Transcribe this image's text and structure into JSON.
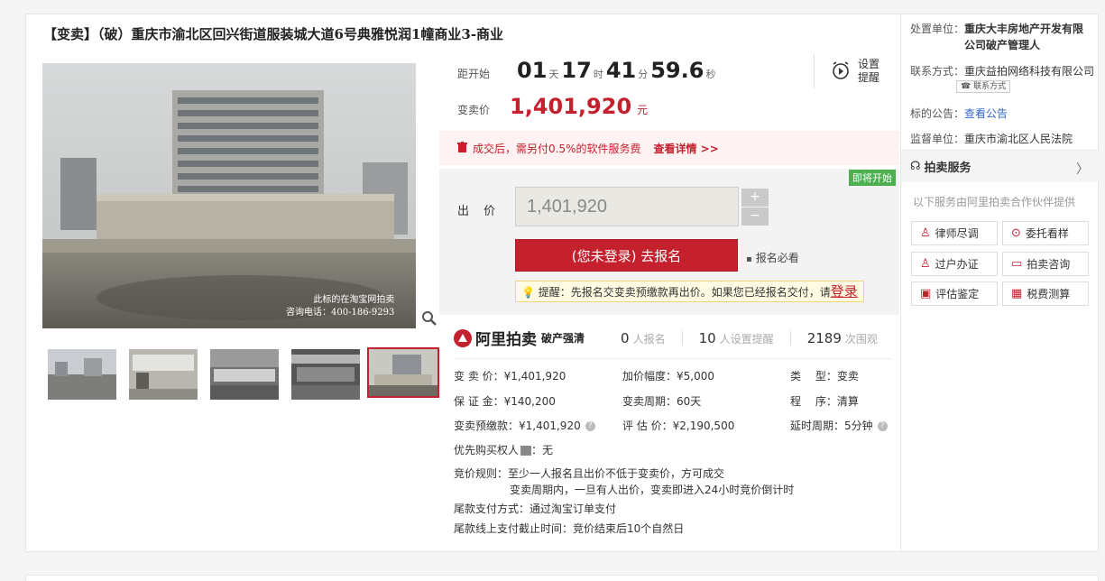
{
  "title": "【变卖】（破）重庆市渝北区回兴街道服装城大道6号典雅悦润1幢商业3-商业",
  "countdown": {
    "label": "距开始",
    "days": "01",
    "days_unit": "天",
    "hours": "17",
    "hours_unit": "时",
    "minutes": "41",
    "minutes_unit": "分",
    "seconds": "59.6",
    "seconds_unit": "秒"
  },
  "remind": {
    "label": "设置提醒"
  },
  "start_price": {
    "label": "变卖价",
    "value": "1,401,920",
    "unit": "元"
  },
  "fee_notice": {
    "text": "成交后，需另付0.5%的软件服务费",
    "link": "查看详情 >>"
  },
  "bid": {
    "status_tag": "即将开始",
    "label": "出 价",
    "input_value": "1,401,920",
    "plus": "+",
    "minus": "−",
    "signup_label": "(您未登录) 去报名",
    "must_see": "报名必看",
    "tip": "提醒：先报名交变卖预缴款再出价。如果您已经报名交付，请",
    "tip_login": "登录"
  },
  "brand": {
    "name": "阿里拍卖",
    "sub": "破产强清"
  },
  "stats": [
    {
      "num": "0",
      "label": "人报名"
    },
    {
      "num": "10",
      "label": "人设置提醒"
    },
    {
      "num": "2189",
      "label": "次围观"
    }
  ],
  "info": {
    "sale_price": "变 卖 价：¥1,401,920",
    "increment": "加价幅度：¥5,000",
    "type_label": "类　 型：",
    "type_value": "变卖",
    "deposit": "保 证 金：¥140,200",
    "period": "变卖周期：60天",
    "procedure_label": "程　 序：",
    "procedure_value": "清算",
    "prepay": "变卖预缴款：¥1,401,920",
    "appraisal": "评 估 价：¥2,190,500",
    "delay": "延时周期：5分钟",
    "priority_label": "优先购买权人",
    "priority_value": "：无",
    "rule_label": "竞价规则：",
    "rule_1": "至少一人报名且出价不低于变卖价，方可成交",
    "rule_2": "变卖周期内，一旦有人出价，变卖即进入24小时竞价倒计时",
    "payment": "尾款支付方式：通过淘宝订单支付",
    "deadline": "尾款线上支付截止时间：竞价结束后10个自然日"
  },
  "image_watermark": {
    "line1": "此标的在淘宝网拍卖",
    "line2": "咨询电话：400-186-9293"
  },
  "side": {
    "disposer_label": "处置单位：",
    "disposer_1": "重庆大丰房地产开发有限",
    "disposer_2": "公司破产管理人",
    "contact_label": "联系方式：",
    "contact_value": "重庆益拍网络科技有限公司",
    "contact_btn": "联系方式",
    "notice_label": "标的公告：",
    "notice_link": "查看公告",
    "supervisor_label": "监督单位：",
    "supervisor_value": "重庆市渝北区人民法院",
    "service_title": "拍卖服务",
    "service_note": "以下服务由阿里拍卖合作伙伴提供",
    "services": [
      "律师尽调",
      "委托看样",
      "过户办证",
      "拍卖咨询",
      "评估鉴定",
      "税费测算"
    ]
  },
  "colors": {
    "accent": "#c4202e",
    "link": "#3366cc",
    "tag_green": "#4caf50"
  }
}
